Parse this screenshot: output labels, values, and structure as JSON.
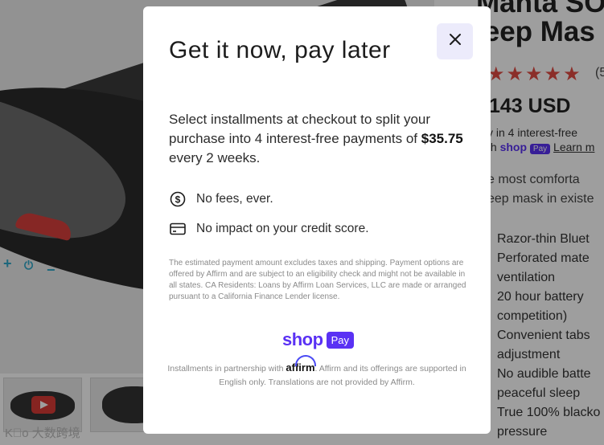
{
  "background": {
    "product_title_lines": [
      "Manta SO",
      "leep Mas"
    ],
    "stars": "★★★★★",
    "rating_count": "(5",
    "price": "143 USD",
    "installments_line1": "y in 4 interest-free",
    "installments_line2_prefix": "th",
    "shop_mini": "shop",
    "pay_mini": "Pay",
    "learn_more": "Learn m",
    "description": "e most comforta\neep mask in existe",
    "features": [
      "Razor-thin Bluet",
      "Perforated mate",
      "ventilation",
      "20 hour battery",
      "competition)",
      "Convenient tabs",
      "adjustment",
      "No audible batte",
      "peaceful sleep",
      "True 100% blacko",
      "pressure"
    ],
    "watermark": "K⃝o 大数跨境"
  },
  "modal": {
    "title": "Get it now, pay later",
    "close_icon": "close-icon",
    "body_prefix": "Select installments at checkout to split your purchase into 4 interest-free payments of ",
    "body_amount": "$35.75",
    "body_suffix": " every 2 weeks.",
    "benefits": [
      {
        "icon": "dollar-circle-icon",
        "text": "No fees, ever."
      },
      {
        "icon": "credit-card-icon",
        "text": "No impact on your credit score."
      }
    ],
    "disclaimer": "The estimated payment amount excludes taxes and shipping. Payment options are offered by Affirm and are subject to an eligibility check and might not be available in all states. CA Residents: Loans by Affirm Loan Services, LLC are made or arranged pursuant to a California Finance Lender license.",
    "shop_word": "shop",
    "pay_badge": "Pay",
    "partner_prefix": "Installments in partnership with ",
    "affirm": "affirm",
    "partner_suffix": ". Affirm and its offerings are supported in English only. Translations are not provided by Affirm."
  },
  "colors": {
    "accent": "#5a31f4",
    "close_bg": "#ecebfb",
    "overlay": "rgba(0,0,0,0.38)"
  }
}
